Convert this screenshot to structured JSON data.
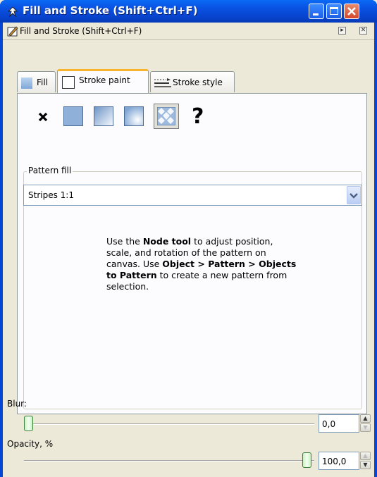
{
  "window": {
    "title": "Fill and Stroke (Shift+Ctrl+F)"
  },
  "dock": {
    "title": "Fill and Stroke (Shift+Ctrl+F)"
  },
  "tabs": [
    {
      "label": "Fill"
    },
    {
      "label": "Stroke paint"
    },
    {
      "label": "Stroke style"
    }
  ],
  "paint_modes": [
    "no-paint-icon",
    "flat-color-icon",
    "linear-gradient-icon",
    "radial-gradient-icon",
    "pattern-icon",
    "unset-paint-icon"
  ],
  "unset_glyph": "?",
  "pattern_fill": {
    "group_label": "Pattern fill",
    "selected": "Stripes 1:1",
    "help": {
      "p1": "Use the ",
      "b1": "Node tool",
      "p2": " to adjust position, scale, and rotation of the pattern on canvas. Use ",
      "b2": "Object > Pattern > Objects to Pattern",
      "p3": " to create a new pattern from selection."
    }
  },
  "blur": {
    "label": "Blur:",
    "value": "0,0",
    "level": 0
  },
  "opacity": {
    "label": "Opacity, %",
    "value": "100,0",
    "level": 100
  },
  "colors": {
    "titlebar": "#0A55E6",
    "active_tab_accent": "#F7B22E",
    "close": "#D4472C"
  }
}
